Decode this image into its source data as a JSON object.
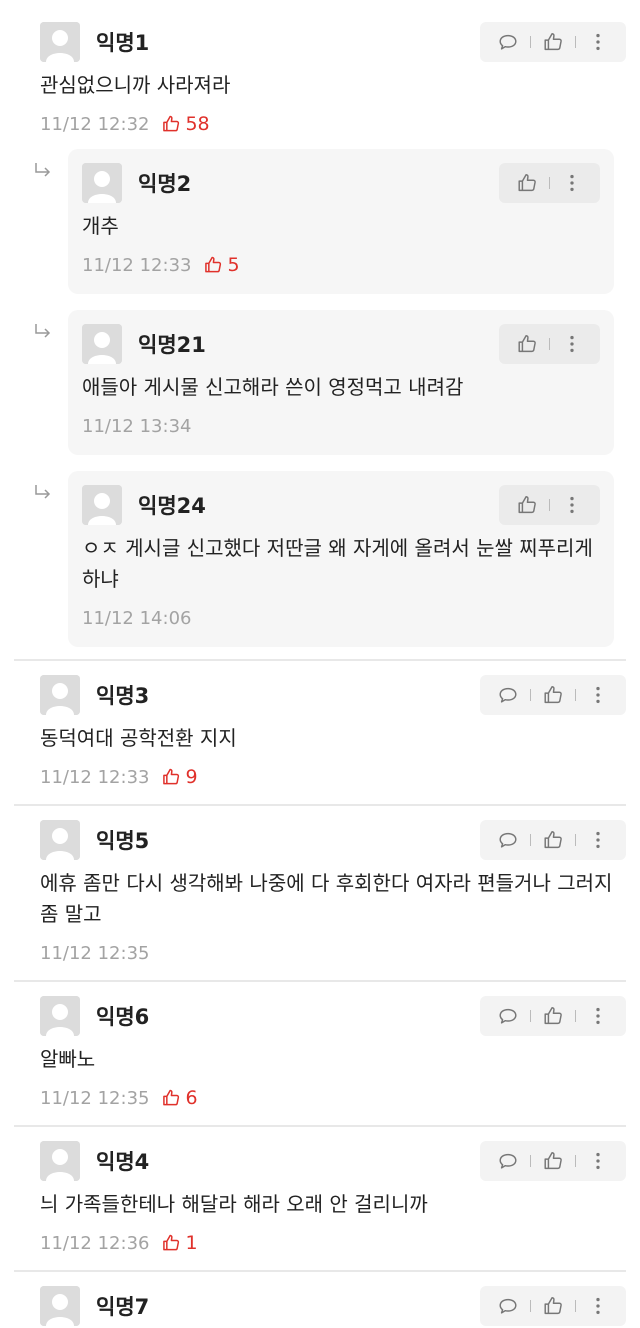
{
  "comments": [
    {
      "nick": "익명1",
      "text": "관심없으니까 사라져라",
      "time": "11/12 12:32",
      "likes": "58"
    },
    {
      "nick": "익명2",
      "text": "개추",
      "time": "11/12 12:33",
      "likes": "5"
    },
    {
      "nick": "익명21",
      "text": "애들아 게시물 신고해라 쓴이 영정먹고 내려감",
      "time": "11/12 13:34",
      "likes": ""
    },
    {
      "nick": "익명24",
      "text": "ㅇㅈ 게시글 신고했다 저딴글 왜 자게에 올려서 눈쌀 찌푸리게하냐",
      "time": "11/12 14:06",
      "likes": ""
    },
    {
      "nick": "익명3",
      "text": "동덕여대 공학전환 지지",
      "time": "11/12 12:33",
      "likes": "9"
    },
    {
      "nick": "익명5",
      "text": "에휴 좀만 다시 생각해봐 나중에 다 후회한다 여자라 편들거나 그러지좀 말고",
      "time": "11/12 12:35",
      "likes": ""
    },
    {
      "nick": "익명6",
      "text": "알빠노",
      "time": "11/12 12:35",
      "likes": "6"
    },
    {
      "nick": "익명4",
      "text": "늬 가족들한테나 해달라 해라 오래 안 걸리니까",
      "time": "11/12 12:36",
      "likes": "1"
    },
    {
      "nick": "익명7",
      "text": "",
      "time": "",
      "likes": ""
    }
  ]
}
